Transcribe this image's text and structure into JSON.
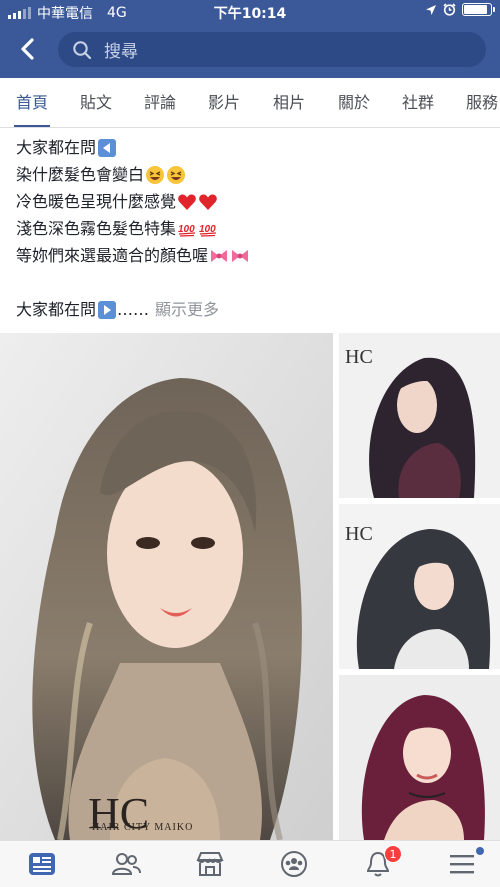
{
  "status_bar": {
    "carrier": "中華電信",
    "network": "4G",
    "time": "下午10:14",
    "battery_level": 0.9
  },
  "header": {
    "back_icon": "chevron-left-icon",
    "search_placeholder": "搜尋"
  },
  "tabs": [
    {
      "label": "首頁",
      "active": true
    },
    {
      "label": "貼文",
      "active": false
    },
    {
      "label": "評論",
      "active": false
    },
    {
      "label": "影片",
      "active": false
    },
    {
      "label": "相片",
      "active": false
    },
    {
      "label": "關於",
      "active": false
    },
    {
      "label": "社群",
      "active": false
    },
    {
      "label": "服務",
      "active": false
    }
  ],
  "post": {
    "lines": [
      "大家都在問",
      "染什麼髮色會變白",
      "冷色暖色呈現什麼感覺",
      "淺色深色霧色髮色特集",
      "等妳們來選最適合的顏色喔"
    ],
    "preview_text": "大家都在問",
    "ellipsis": "……",
    "see_more": "顯示更多"
  },
  "photos": {
    "logo_text": "HC",
    "brand_text": "HAIR CITY MAIKO"
  },
  "bottom_nav": [
    {
      "icon": "news-feed-icon",
      "active": true
    },
    {
      "icon": "friends-icon"
    },
    {
      "icon": "marketplace-icon"
    },
    {
      "icon": "groups-icon"
    },
    {
      "icon": "notifications-icon",
      "badge": "1"
    },
    {
      "icon": "menu-icon",
      "dot": true
    }
  ],
  "colors": {
    "brand": "#3b5998",
    "search_bg": "#2d4a86",
    "badge": "#fa3e3e"
  }
}
